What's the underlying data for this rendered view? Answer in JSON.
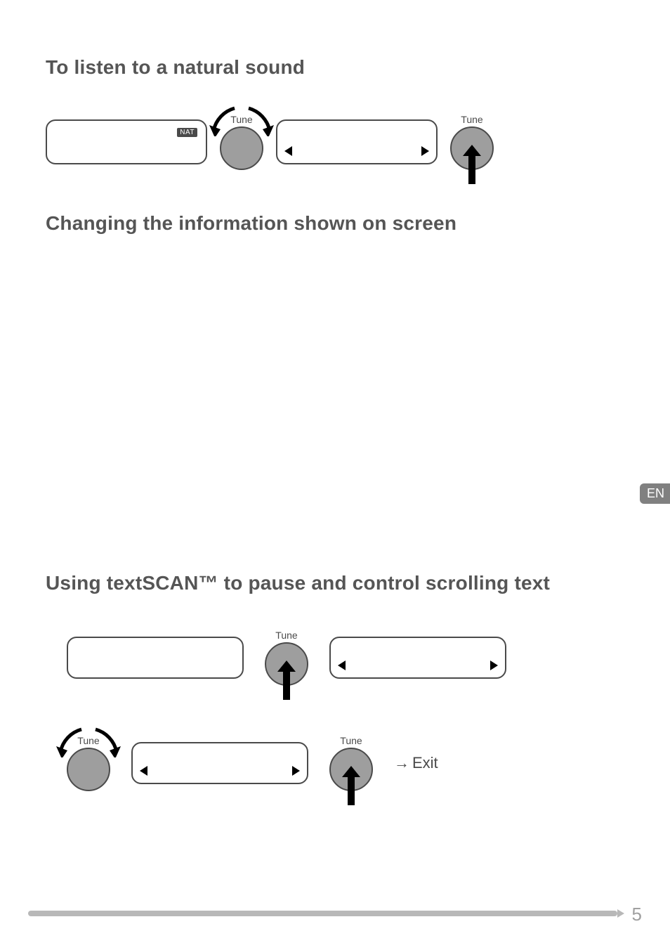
{
  "lang_tab": "EN",
  "page_number": "5",
  "section1": {
    "heading": "To listen to a natural sound",
    "display_tag": "NAT",
    "knob1_label": "Tune",
    "knob2_label": "Tune"
  },
  "section2": {
    "heading": "Changing the information shown on screen"
  },
  "section3": {
    "heading": "Using textSCAN™ to pause and control scrolling text",
    "knob_a_label": "Tune",
    "knob_b_label": "Tune",
    "knob_c_label": "Tune",
    "exit_arrow": "→",
    "exit_text": "Exit"
  }
}
